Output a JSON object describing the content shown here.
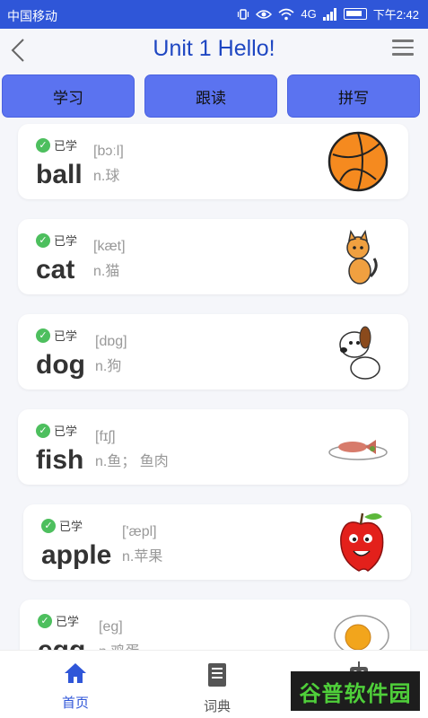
{
  "status": {
    "carrier": "中国移动",
    "signal_label": "4G",
    "time": "下午2:42"
  },
  "header": {
    "title": "Unit 1 Hello!"
  },
  "tabs": [
    {
      "label": "学习"
    },
    {
      "label": "跟读"
    },
    {
      "label": "拼写"
    }
  ],
  "words": [
    {
      "badge": "已学",
      "word": "ball",
      "phonetic": "[bɔːl]",
      "meaning": "n.球",
      "icon": "ball-icon"
    },
    {
      "badge": "已学",
      "word": "cat",
      "phonetic": "[kæt]",
      "meaning": "n.猫",
      "icon": "cat-icon"
    },
    {
      "badge": "已学",
      "word": "dog",
      "phonetic": "[dɒg]",
      "meaning": "n.狗",
      "icon": "dog-icon"
    },
    {
      "badge": "已学",
      "word": "fish",
      "phonetic": "[fɪʃ]",
      "meaning": "n.鱼； 鱼肉",
      "icon": "fish-icon"
    },
    {
      "badge": "已学",
      "word": "apple",
      "phonetic": "['æpl]",
      "meaning": "n.苹果",
      "icon": "apple-icon"
    },
    {
      "badge": "已学",
      "word": "egg",
      "phonetic": "[eg]",
      "meaning": "n.鸡蛋",
      "icon": "egg-icon"
    }
  ],
  "nav": [
    {
      "label": "首页",
      "icon": "home-icon"
    },
    {
      "label": "词典",
      "icon": "book-icon"
    },
    {
      "label": "",
      "icon": "robot-icon"
    }
  ],
  "watermark": "谷普软件园",
  "colors": {
    "accent": "#2f56d8",
    "tab": "#5b73f0",
    "check": "#4dbf5e"
  }
}
